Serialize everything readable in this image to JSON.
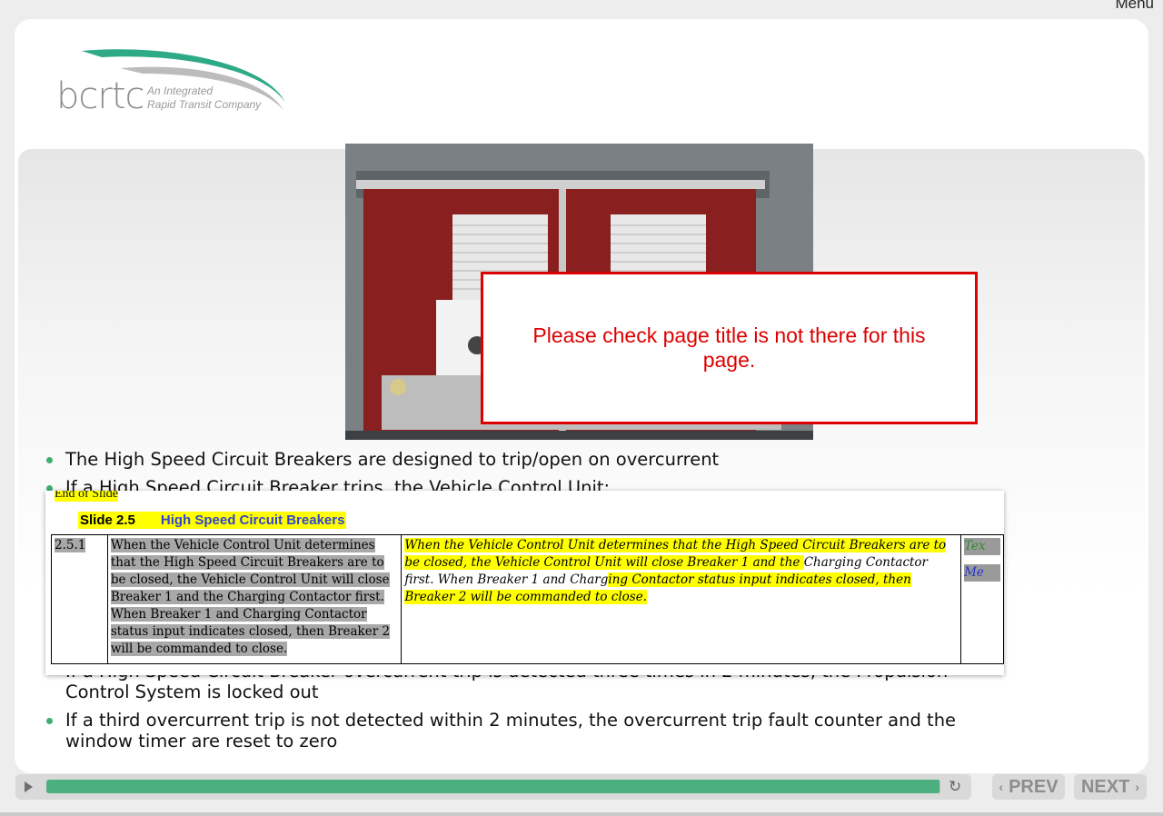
{
  "header": {
    "menu_label": "Menu"
  },
  "logo": {
    "brand": "bcrtc",
    "tagline_1": "An Integrated",
    "tagline_2": "Rapid Transit Company"
  },
  "notice": {
    "text": "Please check page title is not there for this page."
  },
  "bullets": [
    "The High Speed Circuit Breakers are designed to trip/open on overcurrent",
    "If a High Speed Circuit Breaker trips, the Vehicle Control Unit:",
    "If a High Speed Circuit Breaker overcurrent trip is detected three times in 2 minutes, the Propulsion Control System is locked out",
    "If a third overcurrent trip is not detected within 2 minutes, the overcurrent trip fault counter and the window timer are reset to zero"
  ],
  "doc_overlay": {
    "end_of_slide": "End of Slide",
    "slide_number": "Slide 2.5",
    "slide_title": "High Speed Circuit Breakers",
    "row_id": "2.5.1",
    "col2_text": "When the Vehicle Control Unit determines that the High Speed Circuit Breakers are to be closed, the Vehicle Control Unit will close Breaker 1 and the Charging Contactor first. When Breaker 1 and Charging Contactor status input indicates closed, then Breaker 2 will be commanded to close.",
    "col3_part1": "When the Vehicle Control Unit determines that the High Speed Circuit Breakers are to be closed, the Vehicle Control Unit will close Breaker 1 and the ",
    "col3_part2": "Charging Contactor first. When Breaker 1 and Charg",
    "col3_part3": "ing Contactor status input indicates closed, then Breaker 2 will be commanded to close.",
    "col4_line1": "Tex",
    "col4_line2": "Me"
  },
  "player": {
    "progress_fraction": 0.999
  },
  "nav": {
    "prev_label": "PREV",
    "next_label": "NEXT"
  },
  "colors": {
    "accent": "#4caf7f",
    "notice": "#dd0000",
    "highlight": "#ffff00"
  }
}
